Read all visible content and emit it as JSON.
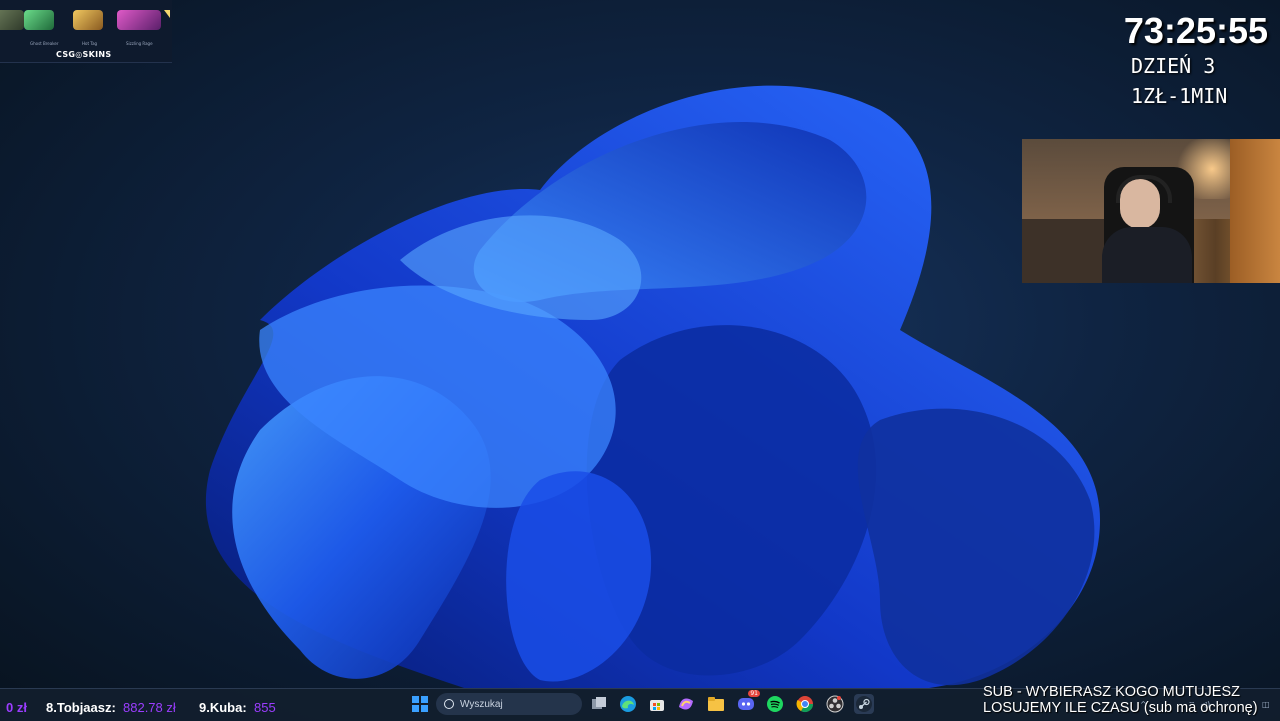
{
  "overlay": {
    "timer": "73:25:55",
    "day": "DZIEŃ 3",
    "rate": "1ZŁ-1MIN",
    "sponsor": {
      "logo_text": "CSG◎SKINS",
      "items": [
        "",
        "Ghost Breaker",
        "Hot Tag",
        "Sizzling Rage"
      ]
    },
    "sub_lines": [
      "SUB - WYBIERASZ KOGO MUTUJESZ",
      "LOSUJEMY ILE CZASU (sub ma ochronę)"
    ]
  },
  "leaderboard": [
    {
      "name": "",
      "amount": "0 zł"
    },
    {
      "name": "8.Tobjaasz:",
      "amount": "882.78 zł"
    },
    {
      "name": "9.Kuba:",
      "amount": "855"
    }
  ],
  "taskbar": {
    "search_placeholder": "Wyszukaj",
    "icons": [
      "windows-start-icon",
      "task-view-icon",
      "edge-icon",
      "store-icon",
      "copilot-icon",
      "file-explorer-icon",
      "discord-icon",
      "spotify-icon",
      "chrome-icon",
      "obs-icon",
      "steam-icon"
    ],
    "discord_badge": "91"
  },
  "colors": {
    "accent_purple": "#9b3dff",
    "wallpaper_blue": "#1f4fe0",
    "taskbar_bg": "#121e2e"
  }
}
